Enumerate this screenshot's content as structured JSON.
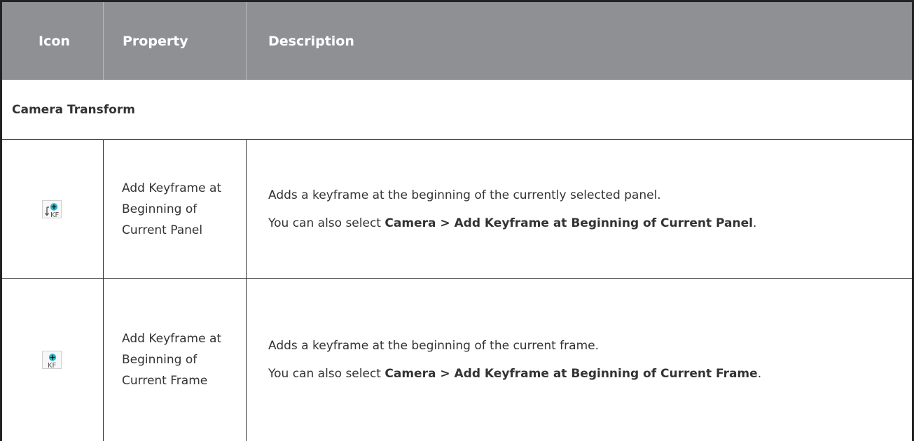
{
  "header": {
    "col_icon": "Icon",
    "col_property": "Property",
    "col_description": "Description"
  },
  "section": {
    "title": "Camera Transform"
  },
  "rows": [
    {
      "icon": "add-keyframe-beginning-panel-icon",
      "property": "Add Keyframe at Beginning of Current Panel",
      "description": "Adds a keyframe at the beginning of the currently selected panel.",
      "menu_prefix": "You can also select ",
      "menu_path": "Camera > Add Keyframe at Beginning of Current Panel",
      "menu_suffix": "."
    },
    {
      "icon": "add-keyframe-current-frame-icon",
      "property": "Add Keyframe at Beginning of Current Frame",
      "description": "Adds a keyframe at the beginning of the current frame.",
      "menu_prefix": "You can also select ",
      "menu_path": "Camera > Add Keyframe at Beginning of Current Frame",
      "menu_suffix": "."
    }
  ],
  "colors": {
    "header_bg": "#8f9094",
    "icon_accent": "#2bb5c7",
    "border": "#333333"
  }
}
